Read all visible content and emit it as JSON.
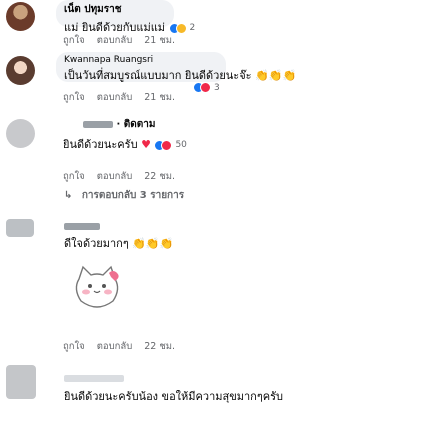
{
  "comments": [
    {
      "author": "เน็ต ปทุมราช",
      "text": "แม่ ยินดีด้วยกับแม่แม่",
      "reaction_count": "2",
      "like_label": "ถูกใจ",
      "reply_label": "ตอบกลับ",
      "time": "21 ชม."
    },
    {
      "author": "Kwannapa Ruangsri",
      "text": "เป็นวันที่สมบูรณ์แบบมาก ยินดีด้วยนะจ๊ะ",
      "reaction_count": "3",
      "like_label": "ถูกใจ",
      "reply_label": "ตอบกลับ",
      "time": "21 ชม."
    },
    {
      "author": "· ติดตาม",
      "text": "ยินดีด้วยนะครับ",
      "reaction_count": "50",
      "like_label": "ถูกใจ",
      "reply_label": "ตอบกลับ",
      "time": "22 ชม.",
      "replies_label": "การตอบกลับ 3 รายการ"
    },
    {
      "text": "ดีใจด้วยมากๆ",
      "sticker": "cat-sticker",
      "like_label": "ถูกใจ",
      "reply_label": "ตอบกลับ",
      "time": "22 ชม."
    },
    {
      "text": "ยินดีด้วยนะครับน้อง ขอให้มีความสุขมากๆครับ"
    }
  ],
  "colors": {
    "bubble": "#f0f2f5",
    "meta": "#65676b",
    "like_blue": "#1877f2",
    "heart": "#f02849",
    "haha": "#f7b928"
  },
  "icons": {
    "reply_arrow": "reply-arrow-icon",
    "heart_emoji": "heart-emoji-icon",
    "hands_emoji": "clap-emoji-icon",
    "heart_eyes_emoji": "heart-eyes-emoji-icon"
  }
}
